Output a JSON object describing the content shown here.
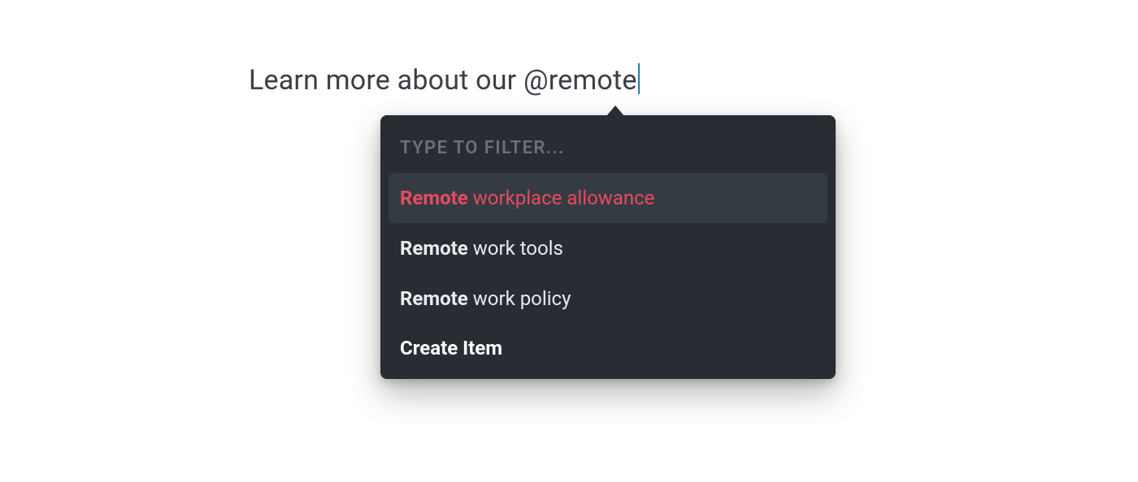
{
  "editor": {
    "text_before_mention": "Learn more about our ",
    "mention_trigger": "@",
    "mention_query": "remote"
  },
  "popover": {
    "filter_label": "TYPE TO FILTER...",
    "suggestions": [
      {
        "match": "Remote",
        "rest": " workplace allowance",
        "selected": true
      },
      {
        "match": "Remote",
        "rest": " work tools",
        "selected": false
      },
      {
        "match": "Remote",
        "rest": " work policy",
        "selected": false
      }
    ],
    "create_label": "Create Item"
  }
}
